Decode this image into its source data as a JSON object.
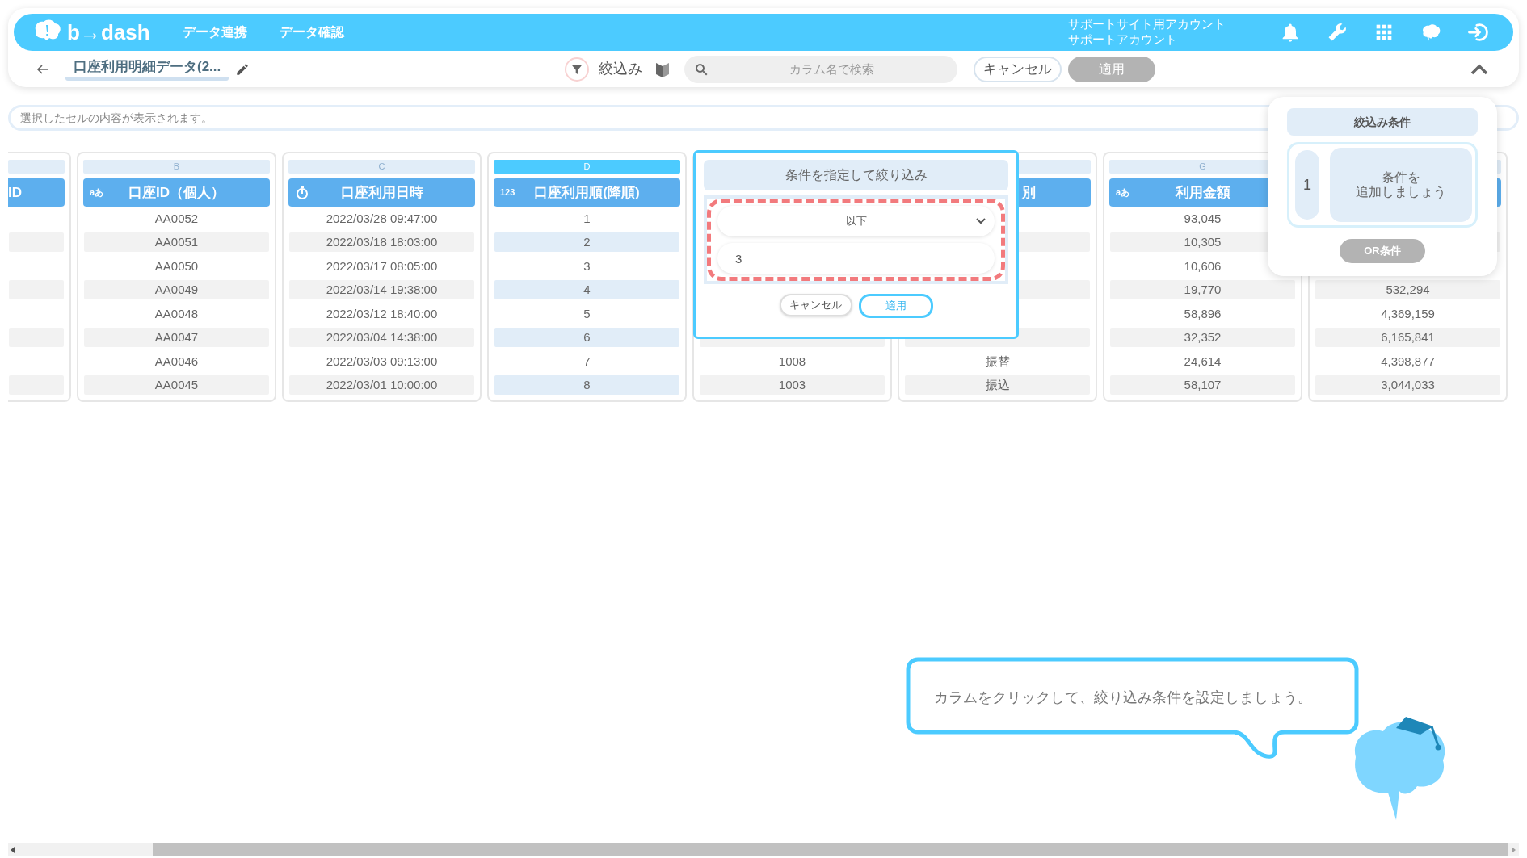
{
  "navbar": {
    "logo": "b→dash",
    "menu": [
      "データ連携",
      "データ確認"
    ],
    "account": [
      "サポートサイト用アカウント",
      "サポートアカウント"
    ]
  },
  "toolbar": {
    "title": "口座利用明細データ(2...",
    "filter_label": "絞込み",
    "search": {
      "placeholder": "カラム名で検索"
    },
    "cancel": "キャンセル",
    "apply": "適用",
    "apply_disabled": true
  },
  "cell_display": {
    "placeholder": "選択したセルの内容が表示されます。"
  },
  "columns": [
    {
      "kind": "partial",
      "header": "ID",
      "selected": false,
      "cells": [
        null,
        null,
        null,
        null,
        null,
        null,
        null,
        null
      ]
    },
    {
      "kind": "text",
      "letter": "B",
      "type_label": "aあ",
      "header": "口座ID（個人）",
      "selected": false,
      "cells": [
        "AA0052",
        "AA0051",
        "AA0050",
        "AA0049",
        "AA0048",
        "AA0047",
        "AA0046",
        "AA0045"
      ]
    },
    {
      "kind": "datetime",
      "letter": "C",
      "header": "口座利用日時",
      "selected": false,
      "cells": [
        "2022/03/28 09:47:00",
        "2022/03/18 18:03:00",
        "2022/03/17 08:05:00",
        "2022/03/14 19:38:00",
        "2022/03/12 18:40:00",
        "2022/03/04 14:38:00",
        "2022/03/03 09:13:00",
        "2022/03/01 10:00:00"
      ]
    },
    {
      "kind": "number",
      "letter": "D",
      "type_label": "123",
      "header": "口座利用順(降順)",
      "selected": true,
      "cells": [
        "1",
        "2",
        "3",
        "4",
        "5",
        "6",
        "7",
        "8"
      ]
    },
    {
      "kind": "plain",
      "selected": false,
      "cells": [
        null,
        null,
        null,
        null,
        null,
        null,
        "1008",
        "1003"
      ]
    },
    {
      "kind": "plain",
      "header": "別",
      "header_cut": true,
      "selected": false,
      "cells": [
        null,
        null,
        null,
        null,
        null,
        null,
        "振替",
        "振込"
      ]
    },
    {
      "kind": "text",
      "letter": "G",
      "type_label": "aあ",
      "header": "利用金額",
      "selected": false,
      "cells": [
        "93,045",
        "10,305",
        "10,606",
        "19,770",
        "58,896",
        "32,352",
        "24,614",
        "58,107"
      ]
    },
    {
      "kind": "plain",
      "selected": false,
      "cells": [
        null,
        null,
        null,
        "532,294",
        "4,369,159",
        "6,165,841",
        "4,398,877",
        "3,044,033"
      ]
    }
  ],
  "filter_popup": {
    "title": "条件を指定して絞り込み",
    "operator": "以下",
    "value": "3",
    "cancel": "キャンセル",
    "apply": "適用"
  },
  "conditions_panel": {
    "title": "絞込み条件",
    "groups": [
      {
        "number": "1",
        "hint_lines": [
          "条件を",
          "追加しましょう"
        ]
      }
    ],
    "or_button": "OR条件"
  },
  "tutorial": {
    "message": "カラムをクリックして、絞り込み条件を設定しましょう。"
  }
}
